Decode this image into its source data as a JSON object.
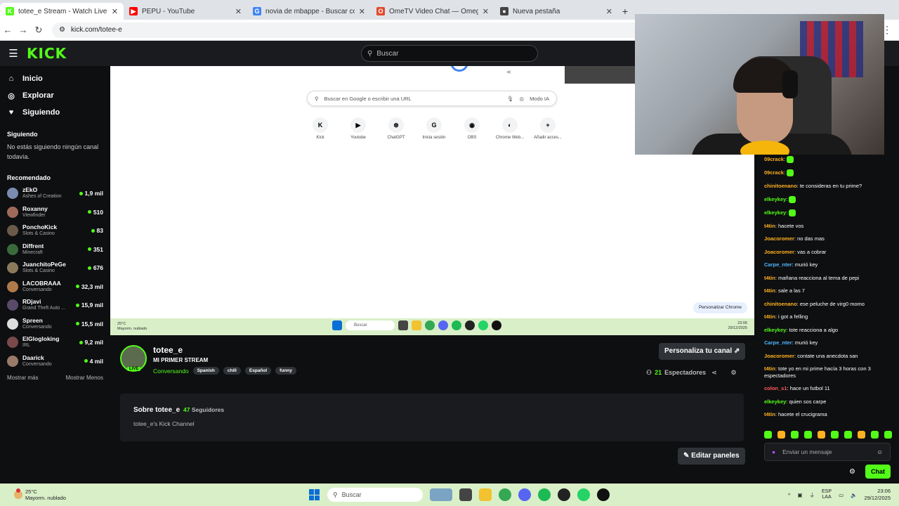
{
  "browser": {
    "tabs": [
      {
        "label": "totee_e Stream - Watch Live on",
        "color": "#53fc18",
        "glyph": "K",
        "active": true
      },
      {
        "label": "PEPU - YouTube",
        "color": "#ff0000",
        "glyph": "▶",
        "active": false
      },
      {
        "label": "novia de mbappe - Buscar con",
        "color": "#4285f4",
        "glyph": "G",
        "active": false
      },
      {
        "label": "OmeTV Video Chat — Omegle",
        "color": "#e24a2b",
        "glyph": "O",
        "active": false
      },
      {
        "label": "Nueva pestaña",
        "color": "#444444",
        "glyph": "●",
        "active": false
      }
    ],
    "url": "kick.com/totee-e"
  },
  "kick": {
    "logo": "KICK",
    "search_placeholder": "Buscar"
  },
  "sidebar": {
    "nav": [
      {
        "icon": "home-icon",
        "glyph": "⌂",
        "label": "Inicio"
      },
      {
        "icon": "compass-icon",
        "glyph": "◎",
        "label": "Explorar"
      },
      {
        "icon": "heart-icon",
        "glyph": "♥",
        "label": "Siguiendo"
      }
    ],
    "following_title": "Siguiendo",
    "following_empty": "No estás siguiendo ningún canal todavía.",
    "recommended_title": "Recomendado",
    "recommended": [
      {
        "name": "zEkO",
        "category": "Ashes of Creation",
        "viewers": "1,9 mil"
      },
      {
        "name": "Roxanny",
        "category": "Viewfinder",
        "viewers": "510"
      },
      {
        "name": "PonchoKick",
        "category": "Slots & Casino",
        "viewers": "83"
      },
      {
        "name": "Diffrent",
        "category": "Minecraft",
        "viewers": "351"
      },
      {
        "name": "JuanchitoPeGe",
        "category": "Slots & Casino",
        "viewers": "676"
      },
      {
        "name": "LACOBRAAA",
        "category": "Conversando",
        "viewers": "32,3 mil"
      },
      {
        "name": "RDjavi",
        "category": "Grand Theft Auto ...",
        "viewers": "15,9 mil"
      },
      {
        "name": "Spreen",
        "category": "Conversando",
        "viewers": "15,5 mil"
      },
      {
        "name": "ElGlogloking",
        "category": "IRL",
        "viewers": "9,2 mil"
      },
      {
        "name": "Daarick",
        "category": "Conversando",
        "viewers": "4 mil"
      }
    ],
    "show_more": "Mostrar más",
    "show_less": "Mostrar Menos"
  },
  "video": {
    "google_search_placeholder": "Buscar en Google o escribir una URL",
    "ai_mode": "Modo IA",
    "shortcuts": [
      {
        "label": "Kick",
        "glyph": "K"
      },
      {
        "label": "Youtube",
        "glyph": "▶"
      },
      {
        "label": "ChatGPT",
        "glyph": "⊛"
      },
      {
        "label": "Inicia sesión",
        "glyph": "G"
      },
      {
        "label": "OBS",
        "glyph": "◉"
      },
      {
        "label": "Chrome Web...",
        "glyph": "◐"
      },
      {
        "label": "Añadir acces...",
        "glyph": "+"
      }
    ],
    "personalize": "Personalizar Chrome",
    "inner_taskbar": {
      "weather_temp": "25°C",
      "weather_desc": "Mayorm. nublado",
      "search": "Buscar",
      "lang": "ESP LAA",
      "time": "23:06",
      "date": "29/12/2025"
    }
  },
  "stream": {
    "streamer": "totee_e",
    "title": "MI PRIMER STREAM",
    "category": "Conversando",
    "tags": [
      "Spanish",
      "chill",
      "Español",
      "funny"
    ],
    "live_label": "LIVE",
    "customize_label": "Personaliza tu canal",
    "viewers_count": "21",
    "viewers_label": "Espectadores",
    "about_title": "Sobre totee_e",
    "followers_count": "47",
    "followers_label": "Seguidores",
    "about_desc": "totee_e's Kick Channel",
    "edit_panels": "Editar paneles"
  },
  "chat": {
    "messages": [
      {
        "user": "09crack",
        "color": "#ffb020",
        "text": "",
        "emote": true
      },
      {
        "user": "09crack",
        "color": "#ffb020",
        "text": "",
        "emote": true
      },
      {
        "user": "chinitoenano",
        "color": "#ffb020",
        "text": "te consideras en tu prime?",
        "emote": false
      },
      {
        "user": "elkeykey",
        "color": "#53fc18",
        "text": "",
        "emote": true
      },
      {
        "user": "elkeykey",
        "color": "#53fc18",
        "text": "",
        "emote": true
      },
      {
        "user": "t4tin",
        "color": "#ffb020",
        "text": "hacete vos",
        "emote": false
      },
      {
        "user": "Joacoromer",
        "color": "#ffb020",
        "text": "no das mas",
        "emote": false
      },
      {
        "user": "Joacoromer",
        "color": "#ffb020",
        "text": "vas a cobrar",
        "emote": false
      },
      {
        "user": "Carpe_nter",
        "color": "#4db7ff",
        "text": "murió key",
        "emote": false
      },
      {
        "user": "t4tin",
        "color": "#ffb020",
        "text": "mañana reacciona al tema de pepi",
        "emote": false
      },
      {
        "user": "t4tin",
        "color": "#ffb020",
        "text": "sale a las 7",
        "emote": false
      },
      {
        "user": "chinitoenano",
        "color": "#ffb020",
        "text": "ese peluche de virg0 momo",
        "emote": false
      },
      {
        "user": "t4tin",
        "color": "#ffb020",
        "text": "i got a felling",
        "emote": false
      },
      {
        "user": "elkeykey",
        "color": "#53fc18",
        "text": "tote reacciona a algo",
        "emote": false
      },
      {
        "user": "Carpe_nter",
        "color": "#4db7ff",
        "text": "murió key",
        "emote": false
      },
      {
        "user": "Joacoromer",
        "color": "#ffb020",
        "text": "contate una anecdota san",
        "emote": false
      },
      {
        "user": "t4tin",
        "color": "#ffb020",
        "text": "tote yo en mi prime hacía 3 horas con 3 espectadores",
        "emote": false
      },
      {
        "user": "colon_s1",
        "color": "#ff5a5a",
        "text": "hace un futbol 11",
        "emote": false
      },
      {
        "user": "elkeykey",
        "color": "#53fc18",
        "text": "quien sos carpe",
        "emote": false
      },
      {
        "user": "t4tin",
        "color": "#ffb020",
        "text": "hacete el crucigrama",
        "emote": false
      }
    ],
    "input_placeholder": "Enviar un mensaje",
    "chat_button": "Chat"
  },
  "taskbar": {
    "weather_temp": "25°C",
    "weather_desc": "Mayorm. nublado",
    "search": "Buscar",
    "lang_top": "ESP",
    "lang_bottom": "LAA",
    "time": "23:06",
    "date": "29/12/2025",
    "apps": [
      {
        "icon": "landscape-icon",
        "color": "#7aa3c4"
      },
      {
        "icon": "file-explorer-icon",
        "color": "#444444"
      },
      {
        "icon": "folder-icon",
        "color": "#f2c230"
      },
      {
        "icon": "chrome-icon",
        "color": "#34a853"
      },
      {
        "icon": "discord-icon",
        "color": "#5865f2"
      },
      {
        "icon": "spotify-icon",
        "color": "#1db954"
      },
      {
        "icon": "obs-icon",
        "color": "#222222"
      },
      {
        "icon": "whatsapp-icon",
        "color": "#25d366"
      },
      {
        "icon": "tiktok-icon",
        "color": "#111111"
      }
    ]
  }
}
